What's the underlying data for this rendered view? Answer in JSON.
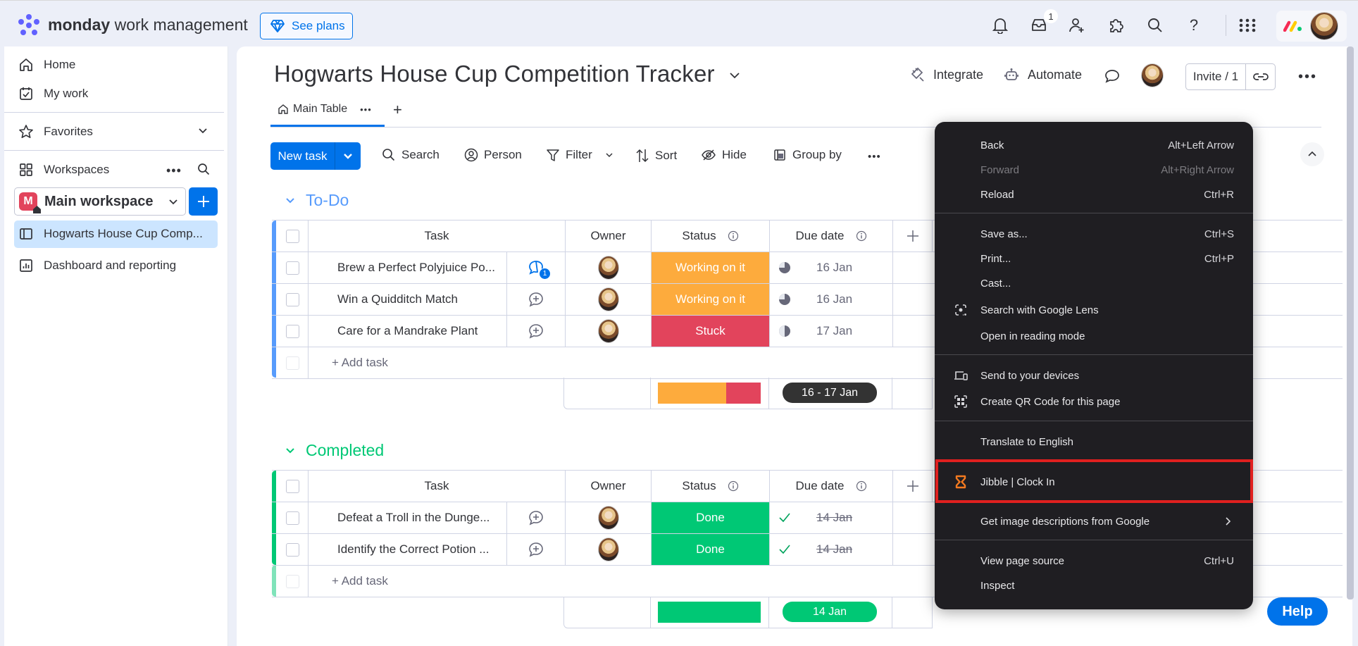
{
  "topbar": {
    "brand_bold": "monday",
    "brand_rest": " work management",
    "see_plans": "See plans",
    "inbox_badge": "1",
    "icons": [
      "bell-icon",
      "inbox-icon",
      "invite-member-icon",
      "apps-puzzle-icon",
      "search-icon",
      "help-icon",
      "app-grid-icon"
    ]
  },
  "sidebar": {
    "home": "Home",
    "my_work": "My work",
    "favorites": "Favorites",
    "workspaces": "Workspaces",
    "workspace_name": "Main workspace",
    "workspace_initial": "M",
    "boards": [
      {
        "label": "Hogwarts House Cup Comp...",
        "active": true,
        "icon": "board-icon"
      },
      {
        "label": "Dashboard and reporting",
        "active": false,
        "icon": "dashboard-icon"
      }
    ]
  },
  "board": {
    "title": "Hogwarts House Cup Competition Tracker",
    "integrate": "Integrate",
    "automate": "Automate",
    "invite": "Invite / 1",
    "tab": "Main Table",
    "add_view": "+"
  },
  "toolbar": {
    "new_task": "New task",
    "search": "Search",
    "person": "Person",
    "filter": "Filter",
    "sort": "Sort",
    "hide": "Hide",
    "group_by": "Group by"
  },
  "columns": {
    "task": "Task",
    "owner": "Owner",
    "status": "Status",
    "due_date": "Due date"
  },
  "groups": [
    {
      "title": "To-Do",
      "color": "#579bfc",
      "rows": [
        {
          "task": "Brew a Perfect Polyjuice Po...",
          "status": "Working on it",
          "status_color": "#fdab3d",
          "due": "16 Jan",
          "comments": "1"
        },
        {
          "task": "Win a Quidditch Match",
          "status": "Working on it",
          "status_color": "#fdab3d",
          "due": "16 Jan",
          "comments": ""
        },
        {
          "task": "Care for a Mandrake Plant",
          "status": "Stuck",
          "status_color": "#e2445c",
          "due": "17 Jan",
          "comments": ""
        }
      ],
      "add_task": "+ Add task",
      "summary_due": "16 - 17 Jan",
      "summary_status_fractions": {
        "working_on_it": 0.667,
        "stuck": 0.333
      }
    },
    {
      "title": "Completed",
      "color": "#00c875",
      "rows": [
        {
          "task": "Defeat a Troll in the Dunge...",
          "status": "Done",
          "status_color": "#00c875",
          "due": "14 Jan",
          "comments": ""
        },
        {
          "task": "Identify the Correct Potion ...",
          "status": "Done",
          "status_color": "#00c875",
          "due": "14 Jan",
          "comments": ""
        }
      ],
      "add_task": "+ Add task",
      "summary_due": "14 Jan",
      "summary_status_fractions": {
        "done": 1.0
      }
    }
  ],
  "context_menu": {
    "items": [
      {
        "label": "Back",
        "shortcut": "Alt+Left Arrow"
      },
      {
        "label": "Forward",
        "shortcut": "Alt+Right Arrow",
        "disabled": true
      },
      {
        "label": "Reload",
        "shortcut": "Ctrl+R"
      },
      {
        "label": "Save as...",
        "shortcut": "Ctrl+S"
      },
      {
        "label": "Print...",
        "shortcut": "Ctrl+P"
      },
      {
        "label": "Cast..."
      },
      {
        "label": "Search with Google Lens",
        "icon": "google-lens-icon"
      },
      {
        "label": "Open in reading mode"
      },
      {
        "label": "Send to your devices",
        "icon": "send-devices-icon"
      },
      {
        "label": "Create QR Code for this page",
        "icon": "qr-code-icon"
      },
      {
        "label": "Translate to English"
      },
      {
        "label": "Jibble | Clock In",
        "icon": "jibble-hourglass-icon",
        "highlighted": true
      },
      {
        "label": "Get image descriptions from Google",
        "submenu": true
      },
      {
        "label": "View page source",
        "shortcut": "Ctrl+U"
      },
      {
        "label": "Inspect"
      }
    ],
    "highlight_color": "#e0201f",
    "jibble_icon_color": "#f47a20"
  },
  "help": "Help"
}
